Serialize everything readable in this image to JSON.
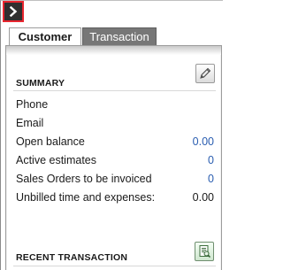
{
  "tabs": [
    {
      "label": "Customer",
      "active": true
    },
    {
      "label": "Transaction",
      "active": false
    }
  ],
  "summary": {
    "title": "SUMMARY",
    "rows": [
      {
        "label": "Phone",
        "value": ""
      },
      {
        "label": "Email",
        "value": ""
      },
      {
        "label": "Open balance",
        "value": "0.00"
      },
      {
        "label": "Active estimates",
        "value": "0"
      },
      {
        "label": "Sales Orders to be invoiced",
        "value": "0"
      },
      {
        "label": "Unbilled time and expenses:",
        "value": "0.00"
      }
    ]
  },
  "recent": {
    "title": "RECENT TRANSACTION"
  },
  "icons": {
    "collapse": "chevron-right-icon",
    "edit": "pencil-icon",
    "report": "report-icon"
  },
  "colors": {
    "link_value": "#2a5db0",
    "collapse_border": "#e8262f",
    "inactive_tab": "#777777"
  }
}
